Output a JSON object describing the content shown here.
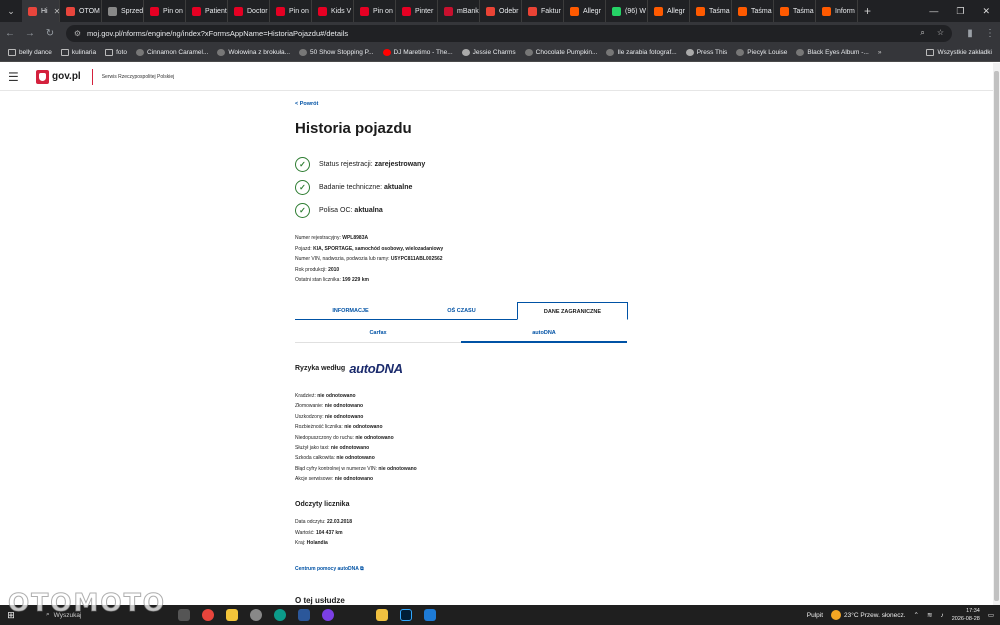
{
  "browser": {
    "tabs": [
      {
        "label": "Hi",
        "color": "#e8453c",
        "active": true
      },
      {
        "label": "OTOM",
        "color": "#e8453c"
      },
      {
        "label": "Sprzed",
        "color": "#888888"
      },
      {
        "label": "Pin on",
        "color": "#e60023"
      },
      {
        "label": "Patient",
        "color": "#e60023"
      },
      {
        "label": "Doctor",
        "color": "#e60023"
      },
      {
        "label": "Pin on",
        "color": "#e60023"
      },
      {
        "label": "Kids V",
        "color": "#e60023"
      },
      {
        "label": "Pin on",
        "color": "#e60023"
      },
      {
        "label": "Pinter",
        "color": "#e60023"
      },
      {
        "label": "mBank",
        "color": "#c8102e"
      },
      {
        "label": "Odebr",
        "color": "#ea4335"
      },
      {
        "label": "Faktur",
        "color": "#ea4335"
      },
      {
        "label": "Allegr",
        "color": "#ff5a00"
      },
      {
        "label": "(96) W",
        "color": "#25d366"
      },
      {
        "label": "Allegr",
        "color": "#ff5a00"
      },
      {
        "label": "Taśma",
        "color": "#ff5a00"
      },
      {
        "label": "Taśma",
        "color": "#ff5a00"
      },
      {
        "label": "Taśma",
        "color": "#ff5a00"
      },
      {
        "label": "Inform",
        "color": "#ff5a00"
      }
    ],
    "url": "moj.gov.pl/nforms/engine/ng/index?xFormsAppName=HistoriaPojazdu#/details",
    "bookmarks": [
      {
        "label": "belly dance",
        "icon": "folder-icon"
      },
      {
        "label": "kulinaria",
        "icon": "folder-icon"
      },
      {
        "label": "foto",
        "icon": "folder-icon"
      },
      {
        "label": "Cinnamon Caramel...",
        "icon": "site-icon"
      },
      {
        "label": "Wołowina z brokuła...",
        "icon": "site-icon"
      },
      {
        "label": "50 Show Stopping P...",
        "icon": "site-icon"
      },
      {
        "label": "DJ Maretimo - The...",
        "icon": "youtube-icon"
      },
      {
        "label": "Jessie Charms",
        "icon": "globe-icon"
      },
      {
        "label": "Chocolate Pumpkin...",
        "icon": "site-icon"
      },
      {
        "label": "Ile zarabia fotograf...",
        "icon": "site-icon"
      },
      {
        "label": "Press This",
        "icon": "globe-icon"
      },
      {
        "label": "Piecyk Louise",
        "icon": "site-icon"
      },
      {
        "label": "Black Eyes Album -...",
        "icon": "site-icon"
      }
    ],
    "bookmarks_more": "»",
    "all_bookmarks": "Wszystkie zakładki"
  },
  "header": {
    "logo": "gov.pl",
    "subtitle": "Serwis Rzeczypospolitej Polskiej"
  },
  "main": {
    "back": "< Powrót",
    "title": "Historia pojazdu",
    "statuses": [
      {
        "label": "Status rejestracji:",
        "value": "zarejestrowany"
      },
      {
        "label": "Badanie techniczne:",
        "value": "aktualne"
      },
      {
        "label": "Polisa OC:",
        "value": "aktualna"
      }
    ],
    "vehicle": [
      {
        "label": "Numer rejestracyjny:",
        "value": "WPL8983A"
      },
      {
        "label": "Pojazd:",
        "value": "KIA, SPORTAGE, samochód osobowy, wielozadaniowy"
      },
      {
        "label": "Numer VIN, nadwozia, podwozia lub ramy:",
        "value": "U5YPC811ABL002562"
      },
      {
        "label": "Rok produkcji:",
        "value": "2010"
      },
      {
        "label": "Ostatni stan licznika:",
        "value": "199 229 km"
      }
    ],
    "tabs": [
      "INFORMACJE",
      "OŚ CZASU",
      "DANE ZAGRANICZNE"
    ],
    "selected_tab": "DANE ZAGRANICZNE",
    "subtabs": [
      "Carfax",
      "autoDNA"
    ],
    "selected_subtab": "autoDNA",
    "risk_title": "Ryzyka według",
    "risk_brand": "autoDNA",
    "risks": [
      {
        "label": "Kradzież:",
        "value": "nie odnotowano"
      },
      {
        "label": "Złomowanie:",
        "value": "nie odnotowano"
      },
      {
        "label": "Uszkodzony:",
        "value": "nie odnotowano"
      },
      {
        "label": "Rozbieżność licznika:",
        "value": "nie odnotowano"
      },
      {
        "label": "Niedopuszczony do ruchu:",
        "value": "nie odnotowano"
      },
      {
        "label": "Służył jako taxi:",
        "value": "nie odnotowano"
      },
      {
        "label": "Szkoda całkowita:",
        "value": "nie odnotowano"
      },
      {
        "label": "Błąd cyfry kontrolnej w numerze VIN:",
        "value": "nie odnotowano"
      },
      {
        "label": "Akcje serwisowe:",
        "value": "nie odnotowano"
      }
    ],
    "odometer_title": "Odczyty licznika",
    "odometer": [
      {
        "label": "Data odczytu:",
        "value": "22.03.2018"
      },
      {
        "label": "Wartość:",
        "value": "104 437 km"
      },
      {
        "label": "Kraj:",
        "value": "Holandia"
      }
    ],
    "help_link": "Centrum pomocy autoDNA",
    "about_title": "O tej usłudze"
  },
  "taskbar": {
    "search": "Wyszukaj",
    "desktop": "Pulpit",
    "weather": "23°C  Przew. słonecz.",
    "time": "17:34",
    "date": "2026-08-28"
  },
  "watermark": "OTOMOTO"
}
